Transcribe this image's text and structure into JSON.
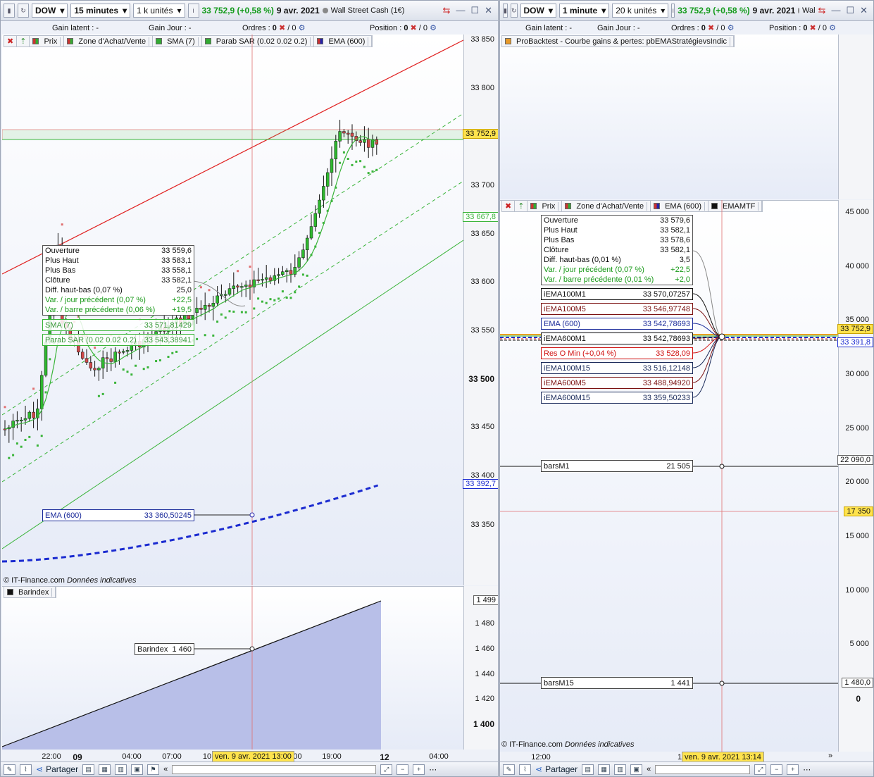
{
  "left_window": {
    "instrument": "DOW",
    "timeframe": "15 minutes",
    "units": "1 k unités",
    "price": "33 752,9 (+0,58 %)",
    "date": "9 avr. 2021",
    "market_name": "Wall Street Cash (1€)",
    "gain_latent_label": "Gain latent :",
    "gain_latent_value": "-",
    "gain_jour_label": "Gain Jour :",
    "gain_jour_value": "-",
    "ordres_label": "Ordres :",
    "ordres_value": "0",
    "ordres_slash": "/ 0",
    "position_label": "Position :",
    "position_value": "0",
    "position_slash": "/ 0",
    "legend": [
      "Prix",
      "Zone d'Achat/Vente",
      "SMA (7)",
      "Parab SAR (0.02 0.02 0.2)",
      "EMA (600)"
    ],
    "yaxis_labels": [
      "33 850",
      "33 800",
      "33 700",
      "33 650",
      "33 600",
      "33 550",
      "33 500",
      "33 450",
      "33 400",
      "33 350"
    ],
    "price_tags": {
      "last": "33 752,9",
      "sma": "33 667,8",
      "ema": "33 392,7"
    },
    "ohlc": {
      "rows": [
        {
          "k": "Ouverture",
          "v": "33 559,6"
        },
        {
          "k": "Plus Haut",
          "v": "33 583,1"
        },
        {
          "k": "Plus Bas",
          "v": "33 558,1"
        },
        {
          "k": "Clôture",
          "v": "33 582,1"
        },
        {
          "k": "Diff. haut-bas (0,07 %)",
          "v": "25,0"
        }
      ],
      "green_rows": [
        {
          "k": "Var. / jour précédent (0,07 %)",
          "v": "+22,5"
        },
        {
          "k": "Var. / barre précédente (0,06 %)",
          "v": "+19,5"
        }
      ]
    },
    "sma_label": {
      "k": "SMA (7)",
      "v": "33 571,81429"
    },
    "sar_label": {
      "k": "Parab SAR (0.02 0.02 0.2)",
      "v": "33 543,38941"
    },
    "ema_label": {
      "k": "EMA (600)",
      "v": "33 360,50245"
    },
    "copyright": "© IT-Finance.com",
    "copyright_note": "Données indicatives",
    "barindex_legend": "Barindex",
    "barindex_axis": [
      "1 499",
      "1 480",
      "1 460",
      "1 440",
      "1 420",
      "1 400"
    ],
    "barindex_label": {
      "k": "Barindex",
      "v": "1 460"
    },
    "xaxis": [
      "22:00",
      "09",
      "04:00",
      "07:00",
      "10",
      ":00",
      "19:00",
      "12",
      "04:00"
    ],
    "cursor_date": "ven. 9 avr. 2021 13:00",
    "share_label": "Partager"
  },
  "right_window": {
    "instrument": "DOW",
    "timeframe": "1 minute",
    "units": "20 k unités",
    "price": "33 752,9 (+0,58 %)",
    "date": "9 avr. 2021",
    "market_name": "Wal",
    "gain_latent_label": "Gain latent :",
    "gain_latent_value": "-",
    "gain_jour_label": "Gain Jour :",
    "gain_jour_value": "-",
    "ordres_label": "Ordres :",
    "ordres_value": "0",
    "ordres_slash": "/ 0",
    "position_label": "Position :",
    "position_value": "0",
    "position_slash": "/ 0",
    "backtest_legend": "ProBacktest - Courbe gains & pertes: pbEMAStratégievsIndic",
    "legend": [
      "Prix",
      "Zone d'Achat/Vente",
      "EMA (600)",
      "EMAMTF"
    ],
    "yaxis_labels": [
      "45 000",
      "40 000",
      "35 000",
      "30 000",
      "25 000",
      "20 000",
      "15 000",
      "10 000",
      "5 000",
      "0"
    ],
    "tags": {
      "last": "33 752,9",
      "ema": "33 391,8",
      "bars1": "22 090,0",
      "cursor": "17 350",
      "bars15": "1 480,0"
    },
    "ohlc": {
      "rows": [
        {
          "k": "Ouverture",
          "v": "33 579,6"
        },
        {
          "k": "Plus Haut",
          "v": "33 582,1"
        },
        {
          "k": "Plus Bas",
          "v": "33 578,6"
        },
        {
          "k": "Clôture",
          "v": "33 582,1"
        },
        {
          "k": "Diff. haut-bas (0,01 %)",
          "v": "3,5"
        }
      ],
      "green_rows": [
        {
          "k": "Var. / jour précédent (0,07 %)",
          "v": "+22,5"
        },
        {
          "k": "Var. / barre précédente (0,01 %)",
          "v": "+2,0"
        }
      ]
    },
    "indicators": [
      {
        "k": "iEMA100M1",
        "v": "33 570,07257",
        "color": "#111111"
      },
      {
        "k": "iEMA100M5",
        "v": "33 546,97748",
        "color": "#7a1010"
      },
      {
        "k": "EMA (600)",
        "v": "33 542,78693",
        "color": "#1a2a9a"
      },
      {
        "k": "iEMA600M1",
        "v": "33 542,78693",
        "color": "#111111"
      },
      {
        "k": "Res O Min (+0,04 %)",
        "v": "33 528,09",
        "color": "#d01010"
      },
      {
        "k": "iEMA100M15",
        "v": "33 516,12148",
        "color": "#1a2a5a"
      },
      {
        "k": "iEMA600M5",
        "v": "33 488,94920",
        "color": "#7a1010"
      },
      {
        "k": "iEMA600M15",
        "v": "33 359,50233",
        "color": "#1a2a5a"
      }
    ],
    "bars_m1": {
      "k": "barsM1",
      "v": "21 505"
    },
    "bars_m15": {
      "k": "barsM15",
      "v": "1 441"
    },
    "copyright": "© IT-Finance.com",
    "copyright_note": "Données indicatives",
    "xaxis": [
      "12:00",
      "1"
    ],
    "cursor_date": "ven. 9 avr. 2021 13:14",
    "share_label": "Partager"
  }
}
